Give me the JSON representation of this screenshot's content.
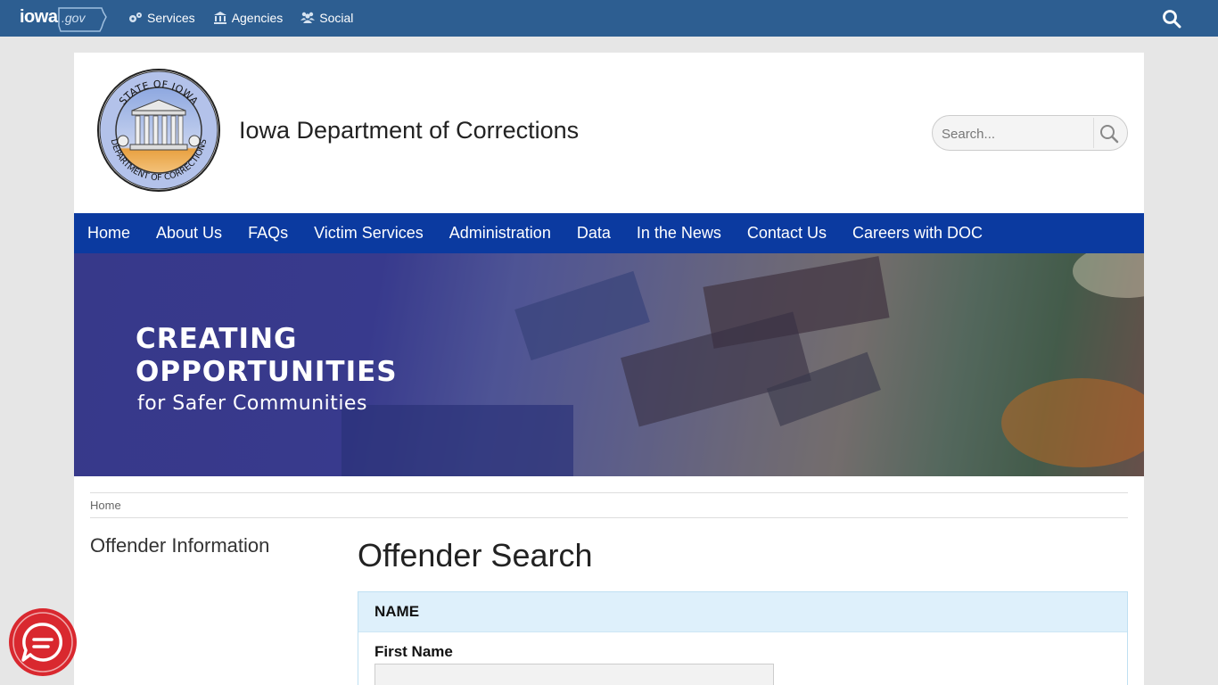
{
  "topbar": {
    "logo_main": "iowa",
    "logo_suffix": ".gov",
    "items": [
      {
        "label": "Services",
        "icon": "gears-icon"
      },
      {
        "label": "Agencies",
        "icon": "building-icon"
      },
      {
        "label": "Social",
        "icon": "users-icon"
      }
    ]
  },
  "header": {
    "seal_text_top": "STATE OF IOWA",
    "seal_text_bottom": "DEPARTMENT OF CORRECTIONS",
    "title": "Iowa Department of Corrections",
    "search_placeholder": "Search..."
  },
  "nav": {
    "items": [
      "Home",
      "About Us",
      "FAQs",
      "Victim Services",
      "Administration",
      "Data",
      "In the News",
      "Contact Us",
      "Careers with DOC"
    ]
  },
  "hero": {
    "line1": "CREATING",
    "line2": "OPPORTUNITIES",
    "line3": "for Safer Communities"
  },
  "breadcrumb": {
    "home": "Home"
  },
  "sidebar": {
    "title": "Offender Information"
  },
  "main": {
    "heading": "Offender Search",
    "panel_title": "NAME",
    "first_name_label": "First Name",
    "first_name_value": ""
  },
  "colors": {
    "topbar": "#2d5e91",
    "nav": "#0b3aa0",
    "panel_head": "#def0fb",
    "chat": "#d9282f"
  }
}
